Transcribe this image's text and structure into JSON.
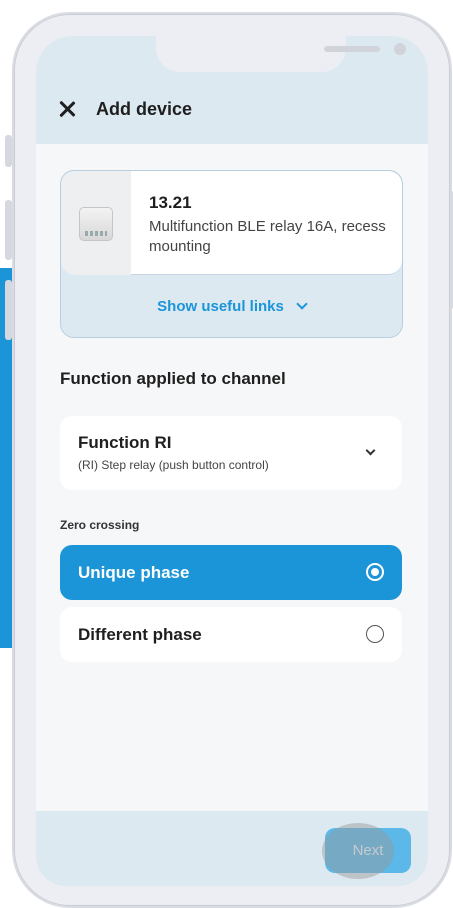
{
  "header": {
    "title": "Add device"
  },
  "device": {
    "code": "13.21",
    "description": "Multifunction BLE relay 16A, recess mounting",
    "links_label": "Show useful links"
  },
  "function_section": {
    "title": "Function applied to channel",
    "selected_name": "Function RI",
    "selected_desc": "(RI) Step relay (push button control)"
  },
  "zero_crossing": {
    "label": "Zero crossing",
    "options": [
      {
        "label": "Unique phase",
        "selected": true
      },
      {
        "label": "Different phase",
        "selected": false
      }
    ]
  },
  "footer": {
    "next_label": "Next"
  },
  "colors": {
    "accent": "#1b95d8",
    "header_bg": "#dde9f1",
    "screen_bg": "#f6f7f9"
  }
}
